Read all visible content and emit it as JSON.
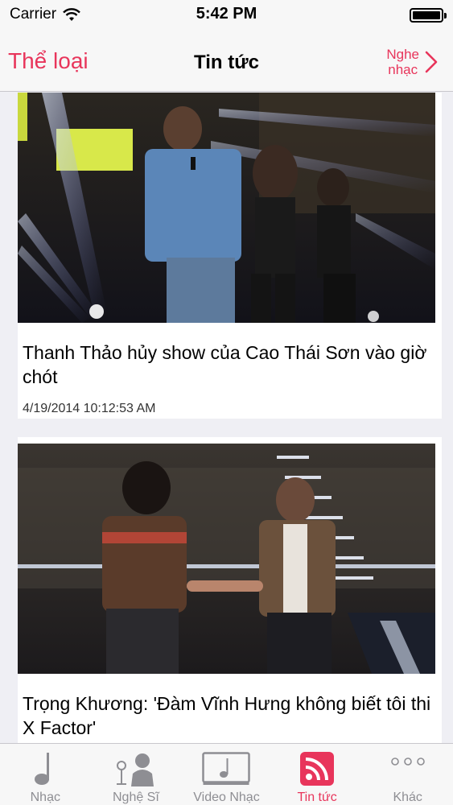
{
  "status_bar": {
    "carrier": "Carrier",
    "time": "5:42 PM"
  },
  "nav": {
    "left_label": "Thể loại",
    "title": "Tin tức",
    "right_label_line1": "Nghe",
    "right_label_line2": "nhạc"
  },
  "articles": [
    {
      "title": "Thanh Thảo hủy show của Cao Thái Sơn vào giờ chót",
      "date": "4/19/2014 10:12:53 AM"
    },
    {
      "title": "Trọng Khương: 'Đàm Vĩnh Hưng không biết tôi thi X Factor'",
      "date": ""
    }
  ],
  "tabs": [
    {
      "label": "Nhạc",
      "icon": "music-note-icon",
      "active": false
    },
    {
      "label": "Nghệ Sĩ",
      "icon": "artist-icon",
      "active": false
    },
    {
      "label": "Video Nhạc",
      "icon": "music-video-icon",
      "active": false
    },
    {
      "label": "Tin tức",
      "icon": "rss-news-icon",
      "active": true
    },
    {
      "label": "Khác",
      "icon": "more-icon",
      "active": false
    }
  ],
  "colors": {
    "accent": "#e8355b",
    "inactive": "#8e8e93",
    "background": "#efeff4"
  }
}
